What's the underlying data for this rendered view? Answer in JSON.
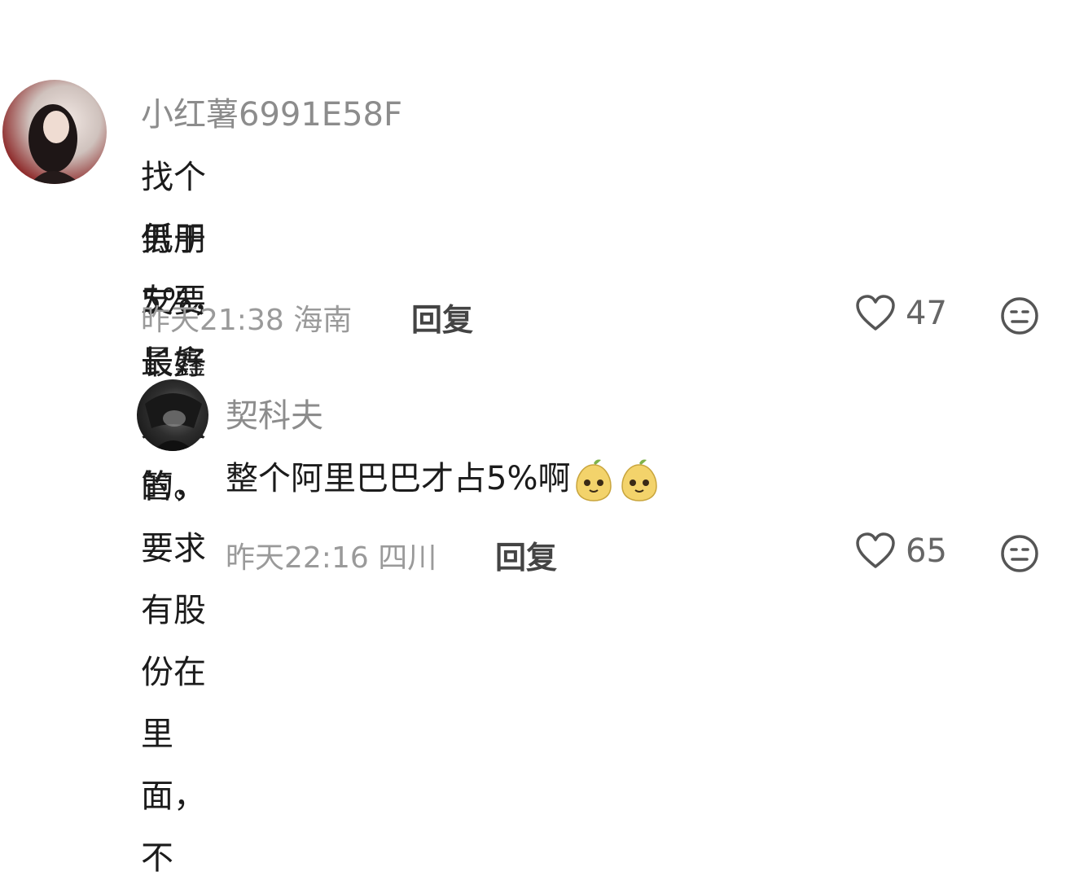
{
  "comments": [
    {
      "username": "小红薯6991E58F",
      "text_line1": "找个男朋友要长鑫科技的，要求有股份在里面，不",
      "text_line2": "低于5%，最好是高管。",
      "time_location": "昨天21:38 海南",
      "reply_label": "回复",
      "likes": "47"
    },
    {
      "username": "契科夫",
      "text": "整个阿里巴巴才占5%啊",
      "emojis": [
        "pear-face-emoji",
        "pear-face-emoji"
      ],
      "time_location": "昨天22:16 四川",
      "reply_label": "回复",
      "likes": "65"
    }
  ],
  "icons": {
    "like": "heart-outline-icon",
    "dislike": "meh-face-icon"
  },
  "colors": {
    "username": "#8c8c8c",
    "body": "#1b1b1b",
    "meta": "#9a9a9a"
  }
}
